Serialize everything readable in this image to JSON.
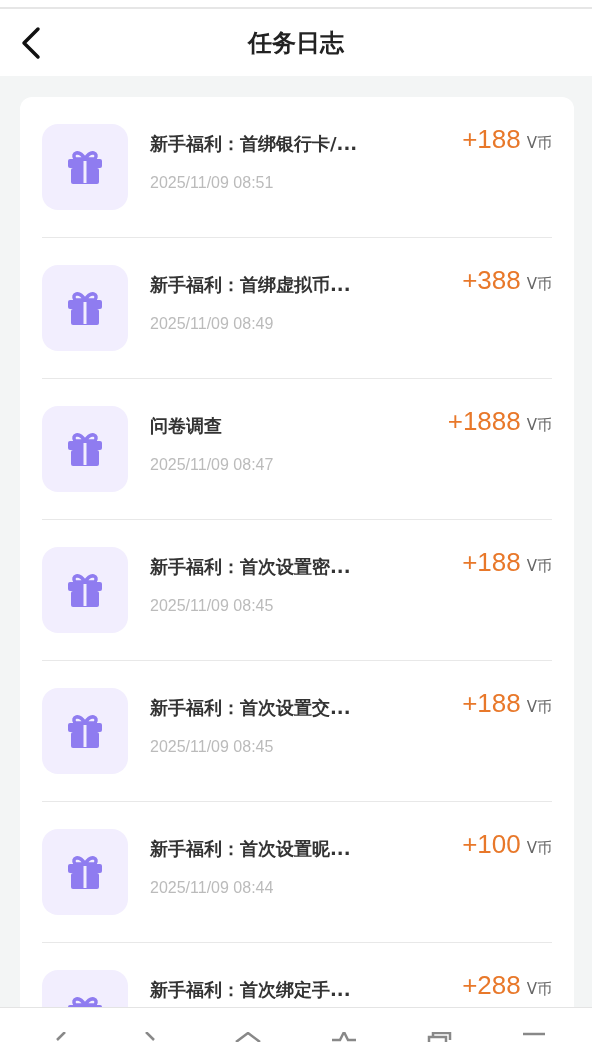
{
  "header": {
    "title": "任务日志"
  },
  "records": [
    {
      "title": "新手福利：首绑银行卡/...",
      "time": "2025/11/09 08:51",
      "amount": "+188",
      "unit": "V币"
    },
    {
      "title": "新手福利：首绑虚拟币...",
      "time": "2025/11/09 08:49",
      "amount": "+388",
      "unit": "V币"
    },
    {
      "title": "问卷调查",
      "time": "2025/11/09 08:47",
      "amount": "+1888",
      "unit": "V币"
    },
    {
      "title": "新手福利：首次设置密...",
      "time": "2025/11/09 08:45",
      "amount": "+188",
      "unit": "V币"
    },
    {
      "title": "新手福利：首次设置交...",
      "time": "2025/11/09 08:45",
      "amount": "+188",
      "unit": "V币"
    },
    {
      "title": "新手福利：首次设置昵...",
      "time": "2025/11/09 08:44",
      "amount": "+100",
      "unit": "V币"
    },
    {
      "title": "新手福利：首次绑定手...",
      "amount": "+288",
      "unit": "V币"
    }
  ]
}
